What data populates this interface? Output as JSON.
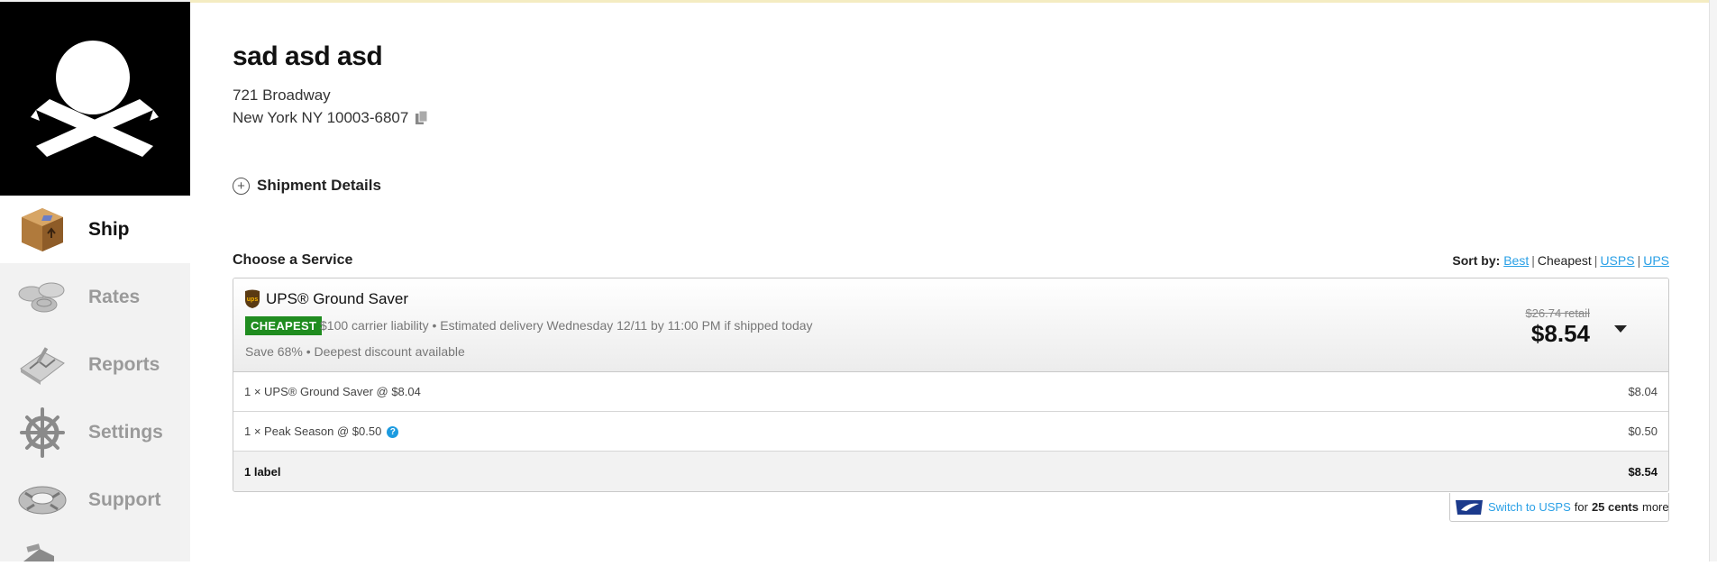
{
  "sidebar": {
    "items": [
      {
        "label": "Ship",
        "active": true,
        "icon": "package-icon"
      },
      {
        "label": "Rates",
        "active": false,
        "icon": "coins-icon"
      },
      {
        "label": "Reports",
        "active": false,
        "icon": "reports-icon"
      },
      {
        "label": "Settings",
        "active": false,
        "icon": "ship-wheel-icon"
      },
      {
        "label": "Support",
        "active": false,
        "icon": "lifebuoy-icon"
      }
    ]
  },
  "recipient": {
    "name": "sad asd asd",
    "address_line1": "721 Broadway",
    "address_line2": "New York NY 10003-6807"
  },
  "shipment_details_label": "Shipment Details",
  "choose_service_label": "Choose a Service",
  "sort": {
    "label": "Sort by:",
    "options": [
      "Best",
      "Cheapest",
      "USPS",
      "UPS"
    ],
    "selected": "Cheapest"
  },
  "service": {
    "name": "UPS® Ground Saver",
    "badge": "CHEAPEST",
    "description": "$100 carrier liability • Estimated delivery Wednesday 12/11 by 11:00 PM if shipped today",
    "savings": "Save 68% • Deepest discount available",
    "retail": "$26.74 retail",
    "price": "$8.54",
    "lines": [
      {
        "label": "1 × UPS® Ground Saver @ $8.04",
        "amount": "$8.04"
      },
      {
        "label": "1 × Peak Season @ $0.50",
        "amount": "$0.50"
      }
    ],
    "total": {
      "label": "1 label",
      "amount": "$8.54"
    }
  },
  "switch_offer": {
    "link": "Switch to USPS",
    "for": "for",
    "amount": "25 cents",
    "suffix": "more"
  },
  "colors": {
    "badge_green": "#1f8c1f",
    "link_blue": "#2aa0e6",
    "ups_brown": "#5a3a12",
    "ups_gold": "#f5b400"
  }
}
